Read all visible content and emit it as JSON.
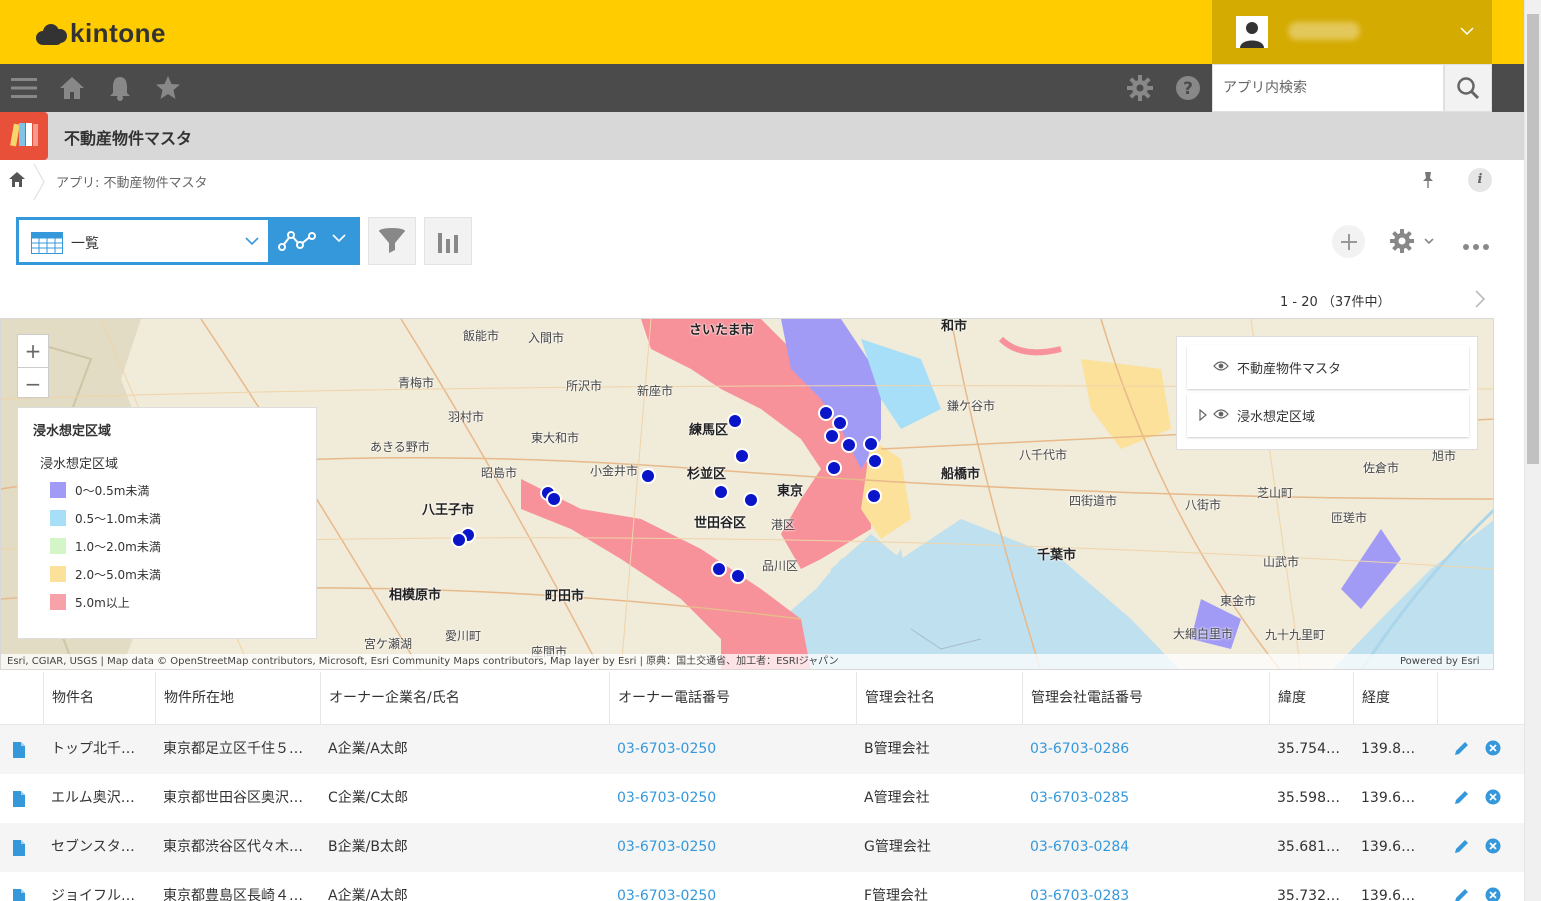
{
  "header": {
    "logo_text": "kintone"
  },
  "search": {
    "placeholder": "アプリ内検索"
  },
  "app": {
    "title": "不動産物件マスタ"
  },
  "breadcrumb": {
    "text": "アプリ: 不動産物件マスタ"
  },
  "info_label": "i",
  "view": {
    "name": "一覧"
  },
  "pager": {
    "text": "1 - 20  （37件中）"
  },
  "map": {
    "places": [
      {
        "name": "飯能市",
        "major": false
      },
      {
        "name": "入間市",
        "major": false
      },
      {
        "name": "さいたま市",
        "major": true
      },
      {
        "name": "和市",
        "major": true
      },
      {
        "name": "青梅市",
        "major": false
      },
      {
        "name": "所沢市",
        "major": false
      },
      {
        "name": "新座市",
        "major": false
      },
      {
        "name": "鎌ケ谷市",
        "major": false
      },
      {
        "name": "羽村市",
        "major": false
      },
      {
        "name": "東大和市",
        "major": false
      },
      {
        "name": "練馬区",
        "major": true
      },
      {
        "name": "あきる野市",
        "major": false
      },
      {
        "name": "昭島市",
        "major": false
      },
      {
        "name": "小金井市",
        "major": false
      },
      {
        "name": "杉並区",
        "major": true
      },
      {
        "name": "八千代市",
        "major": false
      },
      {
        "name": "船橋市",
        "major": true
      },
      {
        "name": "四街道市",
        "major": false
      },
      {
        "name": "八王子市",
        "major": true
      },
      {
        "name": "東京",
        "major": true
      },
      {
        "name": "世田谷区",
        "major": true
      },
      {
        "name": "港区",
        "major": false
      },
      {
        "name": "品川区",
        "major": false
      },
      {
        "name": "千葉市",
        "major": true
      },
      {
        "name": "八街市",
        "major": false
      },
      {
        "name": "相模原市",
        "major": true
      },
      {
        "name": "町田市",
        "major": true
      },
      {
        "name": "佐倉市",
        "major": false
      },
      {
        "name": "旭市",
        "major": false
      },
      {
        "name": "匝瑳市",
        "major": false
      },
      {
        "name": "芝山町",
        "major": false
      },
      {
        "name": "山武市",
        "major": false
      },
      {
        "name": "東金市",
        "major": false
      },
      {
        "name": "大網白里市",
        "major": false
      },
      {
        "name": "九十九里町",
        "major": false
      },
      {
        "name": "座間市",
        "major": false
      },
      {
        "name": "愛川町",
        "major": false
      },
      {
        "name": "宮ケ瀬湖",
        "major": false
      }
    ],
    "legend": {
      "title": "浸水想定区域",
      "subtitle": "浸水想定区域",
      "items": [
        {
          "label": "0～0.5m未満",
          "color": "#a29bf5"
        },
        {
          "label": "0.5～1.0m未満",
          "color": "#a6dff7"
        },
        {
          "label": "1.0～2.0m未満",
          "color": "#d4f5c7"
        },
        {
          "label": "2.0～5.0m未満",
          "color": "#fbe19a"
        },
        {
          "label": "5.0m以上",
          "color": "#f7a1a8"
        }
      ]
    },
    "layers": [
      {
        "label": "不動産物件マスタ"
      },
      {
        "label": "浸水想定区域"
      }
    ],
    "attribution": "Esri, CGIAR, USGS | Map data © OpenStreetMap contributors, Microsoft, Esri Community Maps contributors, Map layer by Esri | 原典：国土交通省、加工者：ESRIジャパン",
    "powered": "Powered by Esri",
    "flood_colors": {
      "deep": "#f7919a",
      "mid": "#fbe19a",
      "shallow": "#a29bf5",
      "light": "#a6dff7"
    },
    "marker_color": "#0a14c8"
  },
  "table": {
    "headers": [
      "物件名",
      "物件所在地",
      "オーナー企業名/氏名",
      "オーナー電話番号",
      "管理会社名",
      "管理会社電話番号",
      "緯度",
      "経度"
    ],
    "rows": [
      {
        "name": "トップ北千…",
        "address": "東京都足立区千住５…",
        "owner": "A企業/A太郎",
        "owner_tel": "03-6703-0250",
        "mgmt": "B管理会社",
        "mgmt_tel": "03-6703-0286",
        "lat": "35.754…",
        "lng": "139.8…"
      },
      {
        "name": "エルム奥沢…",
        "address": "東京都世田谷区奥沢…",
        "owner": "C企業/C太郎",
        "owner_tel": "03-6703-0250",
        "mgmt": "A管理会社",
        "mgmt_tel": "03-6703-0285",
        "lat": "35.598…",
        "lng": "139.6…"
      },
      {
        "name": "セブンスタ…",
        "address": "東京都渋谷区代々木…",
        "owner": "B企業/B太郎",
        "owner_tel": "03-6703-0250",
        "mgmt": "G管理会社",
        "mgmt_tel": "03-6703-0284",
        "lat": "35.681…",
        "lng": "139.6…"
      },
      {
        "name": "ジョイフル…",
        "address": "東京都豊島区長崎４…",
        "owner": "A企業/A太郎",
        "owner_tel": "03-6703-0250",
        "mgmt": "F管理会社",
        "mgmt_tel": "03-6703-0283",
        "lat": "35.732…",
        "lng": "139.6…"
      }
    ]
  }
}
